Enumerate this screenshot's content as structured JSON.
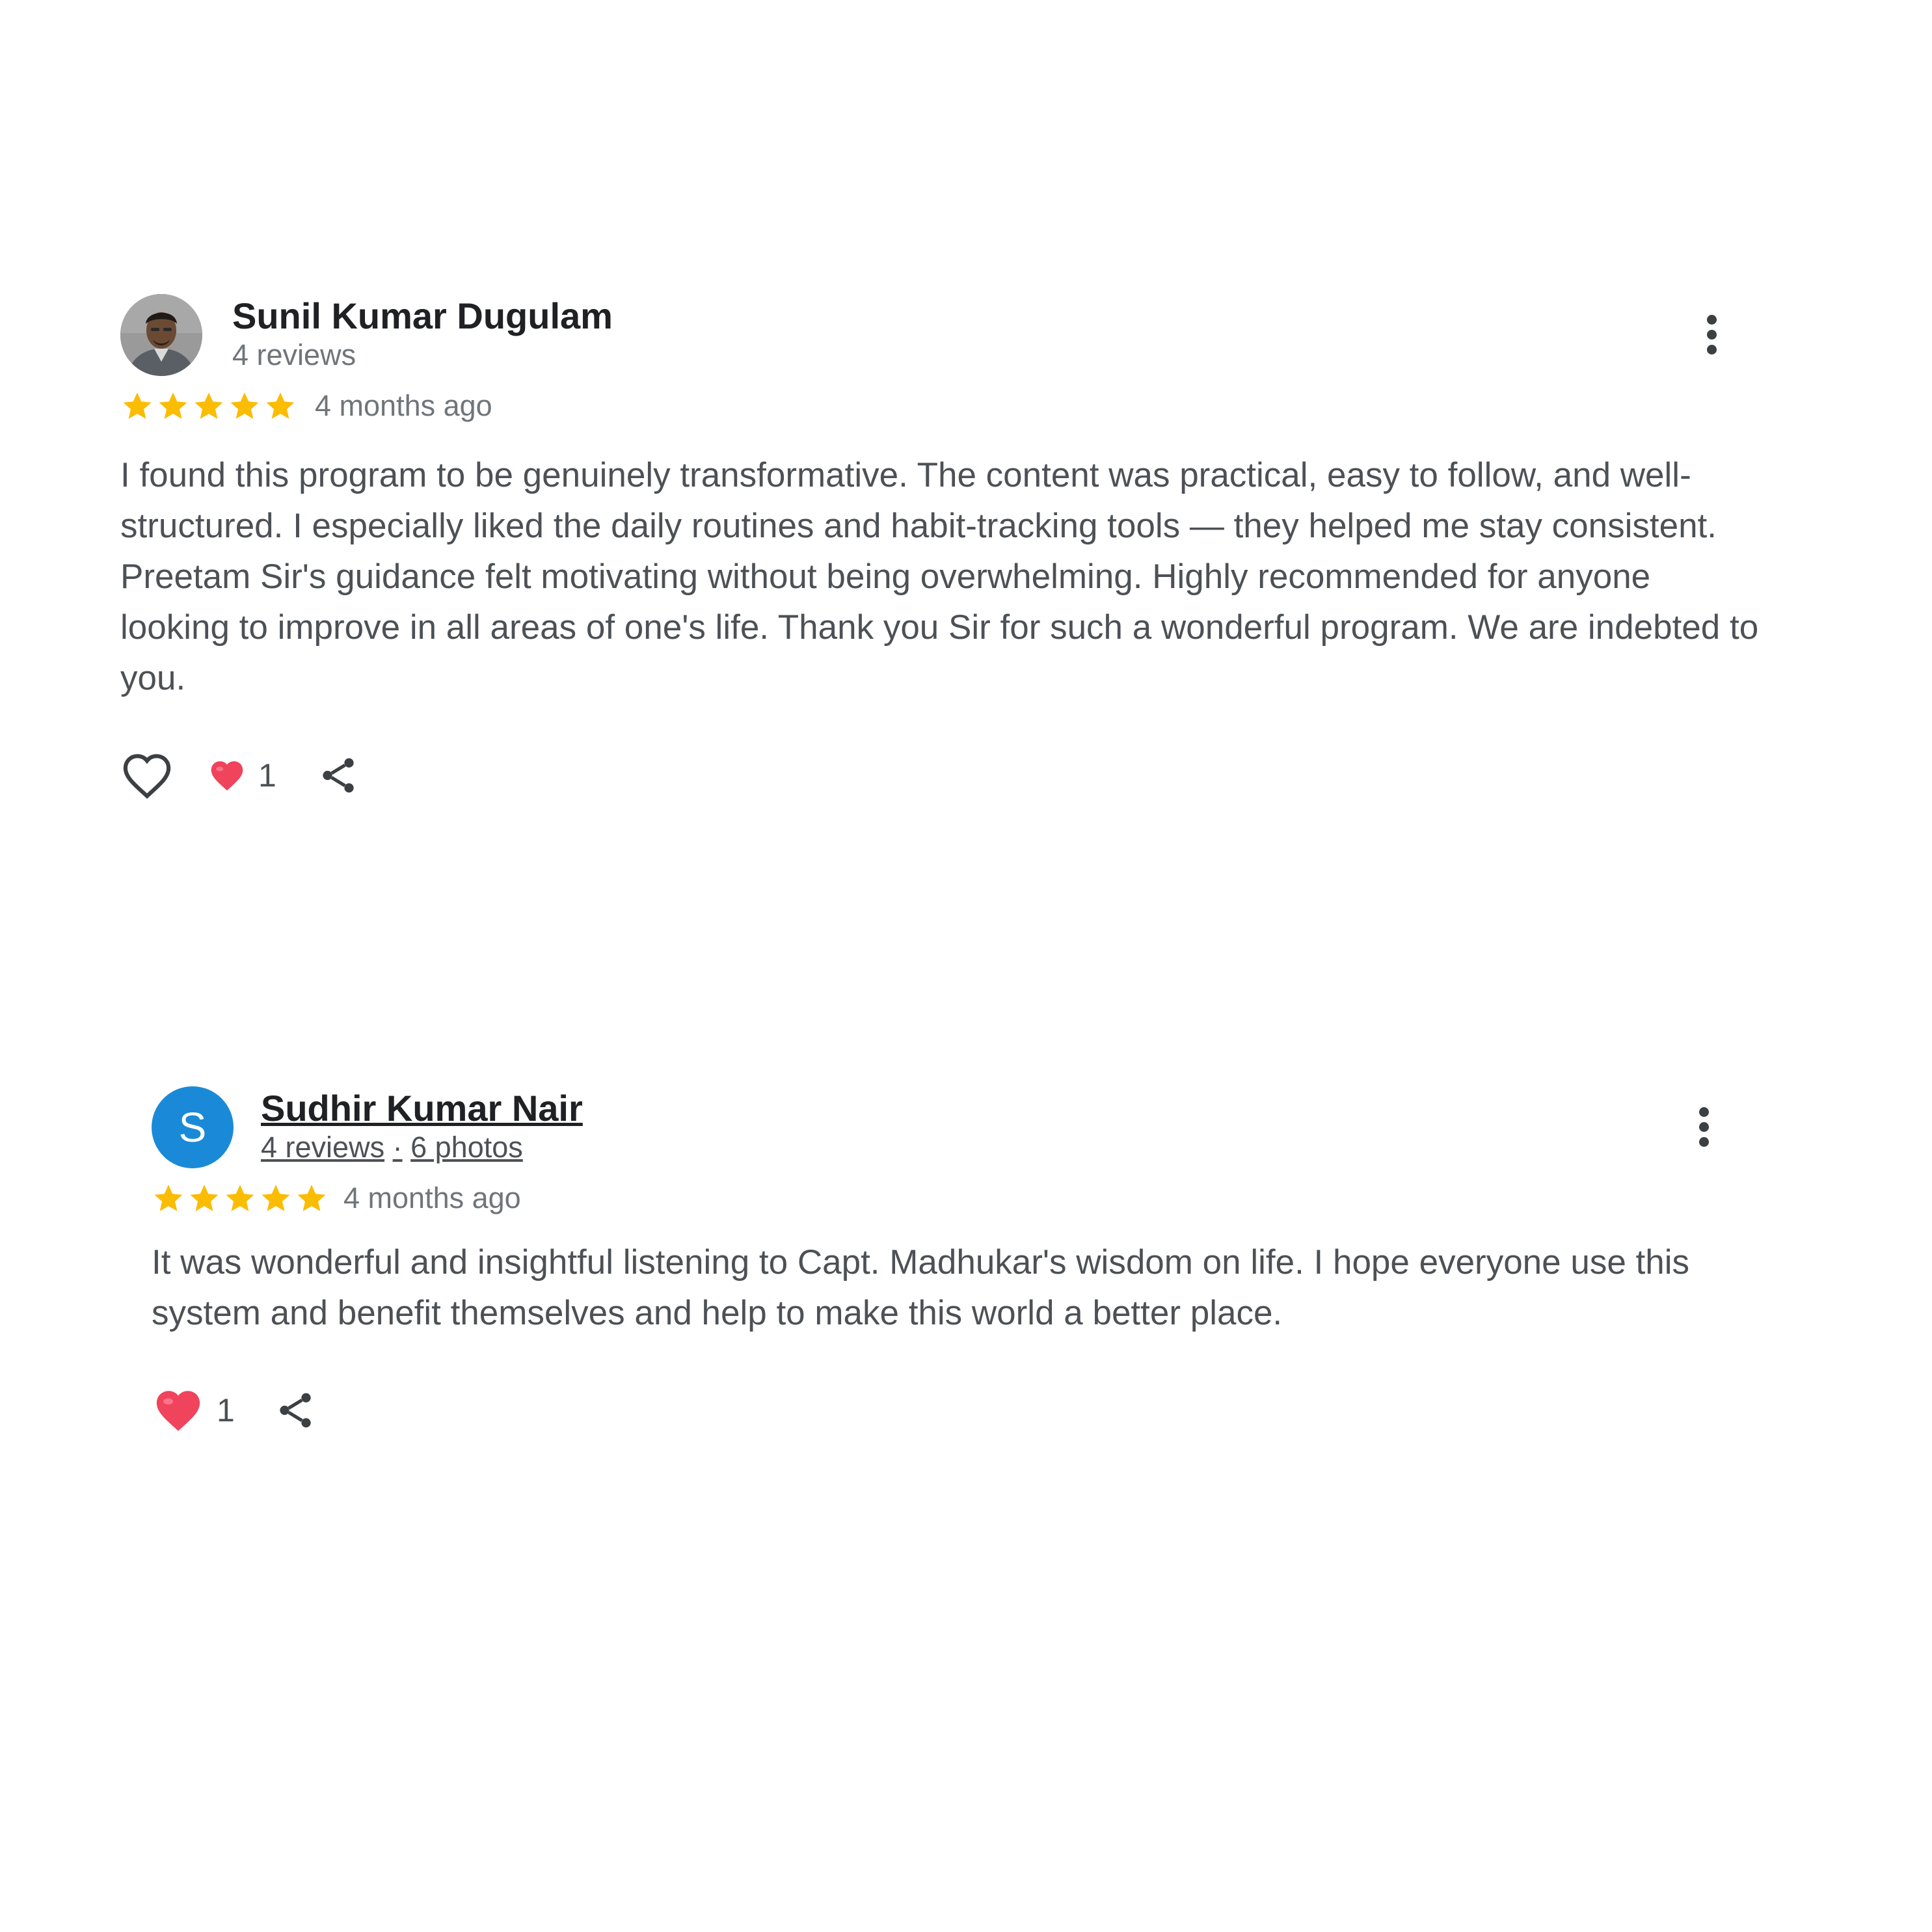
{
  "reviews": [
    {
      "author": "Sunil Kumar Dugulam",
      "meta": "4 reviews",
      "rating": 5,
      "time": "4 months ago",
      "text": "I found this program to be genuinely transformative. The content was practical, easy to follow, and well-structured. I especially liked the daily routines and habit-tracking tools — they helped me stay consistent. Preetam Sir's guidance felt motivating without being overwhelming. Highly recommended for anyone looking to improve in all areas of one's life. Thank you Sir for such a wonderful program. We are indebted to you.",
      "reaction_count": "1"
    },
    {
      "author": "Sudhir Kumar Nair",
      "avatar_letter": "S",
      "meta_reviews": "4 reviews",
      "meta_separator": "·",
      "meta_photos": "6 photos",
      "rating": 5,
      "time": "4 months ago",
      "text": "It was wonderful and insightful listening to Capt. Madhukar's wisdom on life. I hope everyone use this system and benefit themselves and help to make this world a better place.",
      "reaction_count": "1"
    }
  ],
  "colors": {
    "star": "#fbbc04",
    "heart": "#f0435c",
    "avatar_bg": "#1a8ad8"
  },
  "icons": [
    "more-vert-icon",
    "star-icon",
    "heart-outline-icon",
    "heart-filled-icon",
    "share-icon"
  ]
}
